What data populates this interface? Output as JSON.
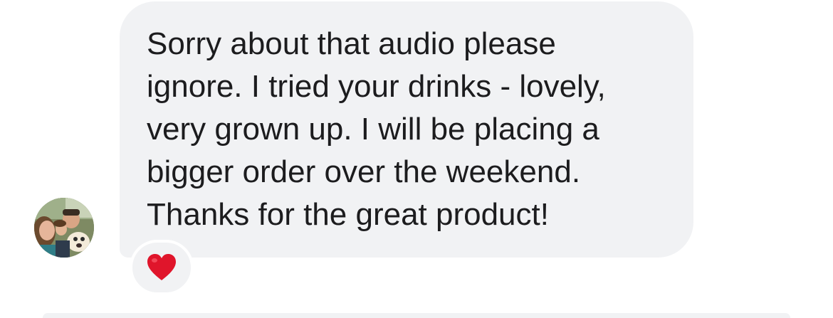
{
  "message": {
    "lines": [
      "Sorry about that audio please",
      "ignore. I tried your drinks - lovely,",
      "very grown up. I will be placing a",
      "bigger order over the weekend.",
      "Thanks for the great product!"
    ]
  },
  "reaction": {
    "icon": "red-heart-icon",
    "color": "#e0152b"
  },
  "avatar": {
    "icon": "user-avatar-photo"
  },
  "colors": {
    "bubble_background": "#f1f2f4",
    "text": "#1c1c1e"
  }
}
